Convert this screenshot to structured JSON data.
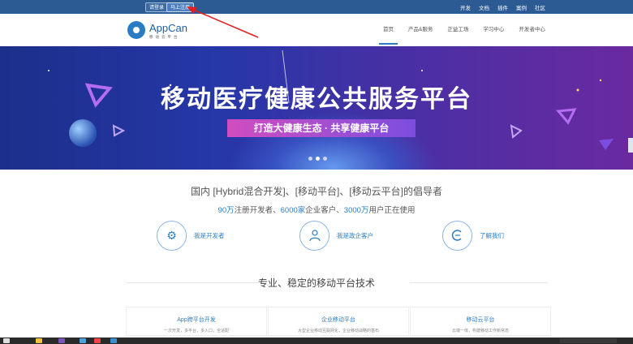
{
  "topbar": {
    "login_label": "请登录",
    "register_label": "马上注册",
    "links": [
      "开发",
      "文档",
      "插件",
      "案例",
      "社区"
    ]
  },
  "header": {
    "logo_name": "AppCan",
    "logo_sub": "移动云平台",
    "nav": [
      "首页",
      "产品&服务",
      "正益工场",
      "学习中心",
      "开发者中心"
    ],
    "active_nav": "首页"
  },
  "banner": {
    "title": "移动医疗健康公共服务平台",
    "slogan": "打造大健康生态 · 共享健康平台",
    "slide_count": 3,
    "active_slide": 2
  },
  "intro": {
    "headline": "国内 [Hybrid混合开发]、[移动平台]、[移动云平台]的倡导者",
    "stat1_value": "90万",
    "stat1_text": "注册开发者、",
    "stat2_value": "6000家",
    "stat2_text": "企业客户、",
    "stat3_value": "3000万",
    "stat3_text": "用户正在使用"
  },
  "cards": [
    {
      "label": "我是开发者",
      "icon": "gear-icon"
    },
    {
      "label": "我是政企客户",
      "icon": "user-icon"
    },
    {
      "label": "了解我们",
      "icon": "logo-c-icon"
    }
  ],
  "section": {
    "title": "专业、稳定的移动平台技术"
  },
  "panels": [
    {
      "title": "App跨平台开发",
      "desc": "一次开发，多平台，多入口，全适配"
    },
    {
      "title": "企业移动平台",
      "desc": "大型企业移动互联网化，企业移动战略的基石"
    },
    {
      "title": "移动云平台",
      "desc": "云端一体，构建移动工作新常态"
    }
  ],
  "colors": {
    "accent": "#2b7dc3",
    "topbar": "#2c5a92",
    "annotation": "#e02020"
  }
}
